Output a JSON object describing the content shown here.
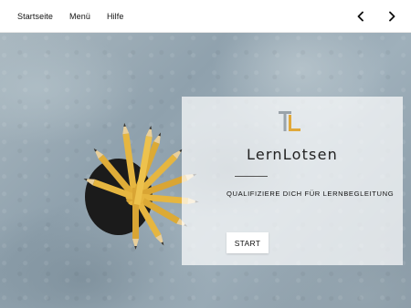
{
  "nav": {
    "items": [
      {
        "label": "Startseite"
      },
      {
        "label": "Menü"
      },
      {
        "label": "Hilfe"
      }
    ],
    "prev_icon": "chevron-left-icon",
    "next_icon": "chevron-right-icon"
  },
  "hero": {
    "logo_icon": "lernlotsen-logo",
    "title": "LernLotsen",
    "tagline": "QUALIFIZIERE DICH FÜR LERNBEGLEITUNG",
    "button_label": "START"
  },
  "colors": {
    "logo_gray": "#9aa3aa",
    "logo_gold": "#e0a83a",
    "pencil_yellow": "#e6b640",
    "pencil_wood": "#e9cf9a",
    "cup": "#1b1b1b"
  }
}
